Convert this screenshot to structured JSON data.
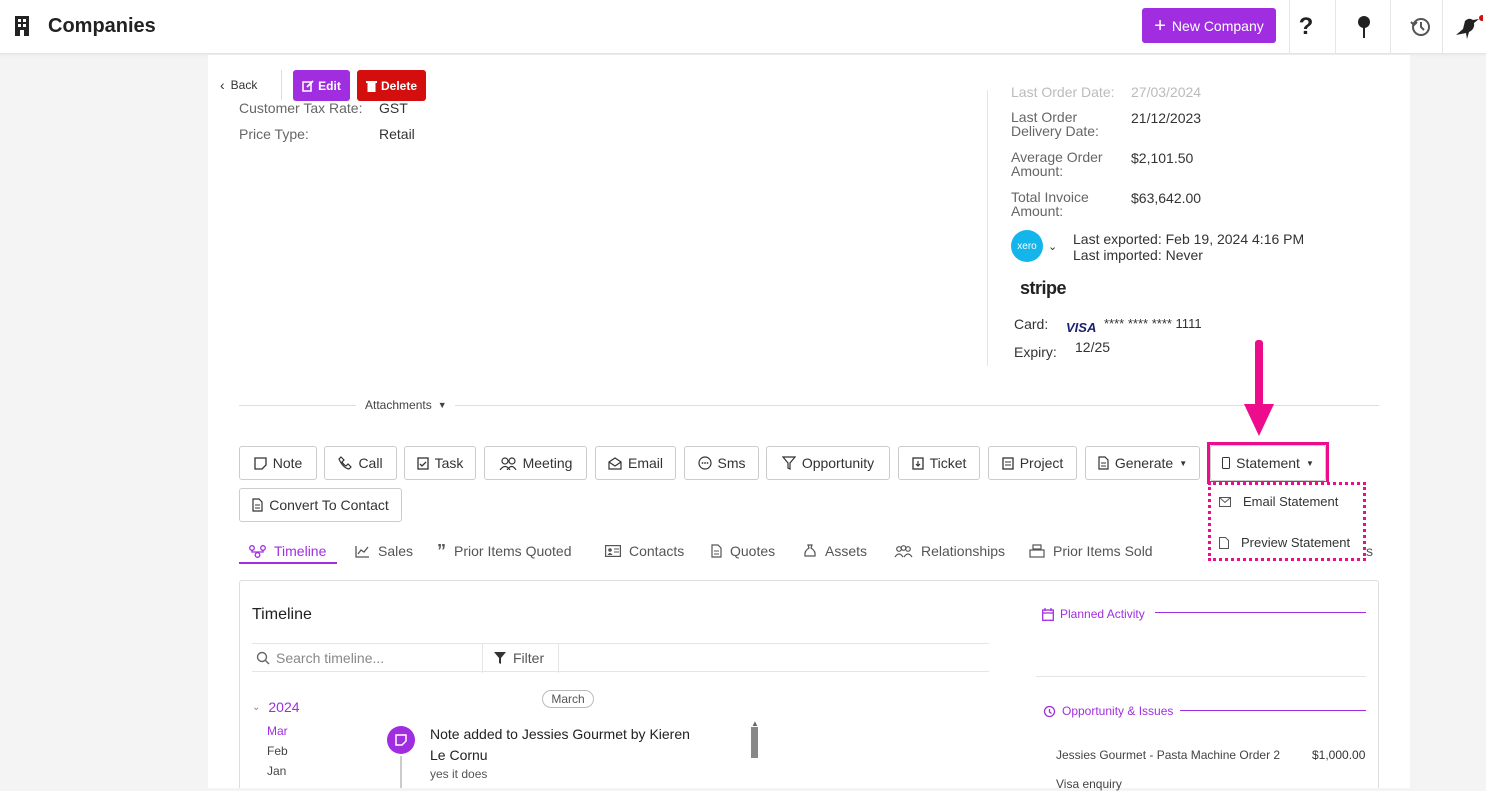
{
  "app": {
    "title": "Companies",
    "new_button": "New Company"
  },
  "toolbar": {
    "back": "Back",
    "edit": "Edit",
    "delete": "Delete"
  },
  "left_fields": [
    {
      "label": "Customer Tax Rate:",
      "value": "GST"
    },
    {
      "label": "Price Type:",
      "value": "Retail"
    }
  ],
  "right_fields": {
    "last_order_date": {
      "label": "Last Order Date:",
      "value": "27/03/2024"
    },
    "last_delivery": {
      "label": "Last Order\nDelivery Date:",
      "value": "21/12/2023"
    },
    "avg_order": {
      "label": "Average Order\nAmount:",
      "value": "$2,101.50"
    },
    "total_invoice": {
      "label": "Total Invoice\nAmount:",
      "value": "$63,642.00"
    }
  },
  "xero": {
    "logo": "xero",
    "last_exported": "Last exported: Feb 19, 2024 4:16 PM",
    "last_imported": "Last imported: Never"
  },
  "stripe": {
    "logo": "stripe",
    "card_label": "Card:",
    "card_brand": "VISA",
    "card_number": "**** **** **** 1111",
    "expiry_label": "Expiry:",
    "expiry": "12/25"
  },
  "attachments": "Attachments",
  "actions": [
    "Note",
    "Call",
    "Task",
    "Meeting",
    "Email",
    "Sms",
    "Opportunity",
    "Ticket",
    "Project",
    "Generate",
    "Statement",
    "Convert To Contact"
  ],
  "statement_menu": [
    "Email Statement",
    "Preview Statement"
  ],
  "tabs": [
    "Timeline",
    "Sales",
    "Prior Items Quoted",
    "Contacts",
    "Quotes",
    "Assets",
    "Relationships",
    "Prior Items Sold"
  ],
  "tabs_overflow_text": "s",
  "timeline": {
    "title": "Timeline",
    "search_placeholder": "Search timeline...",
    "filter": "Filter",
    "year": "2024",
    "months": [
      "Mar",
      "Feb",
      "Jan"
    ],
    "month_pill": "March",
    "entry_title": "Note added to Jessies Gourmet by Kieren Le Cornu",
    "entry_body": "yes it does"
  },
  "side": {
    "planned": "Planned Activity",
    "opps": "Opportunity & Issues",
    "opp_items": [
      {
        "name": "Jessies Gourmet - Pasta Machine Order 2",
        "amount": "$1,000.00"
      },
      {
        "name": "Visa enquiry",
        "amount": ""
      }
    ]
  },
  "colors": {
    "accent": "#a02ee0",
    "danger": "#d40d0d",
    "highlight": "#ec0c8c",
    "xero": "#13b5ea"
  }
}
